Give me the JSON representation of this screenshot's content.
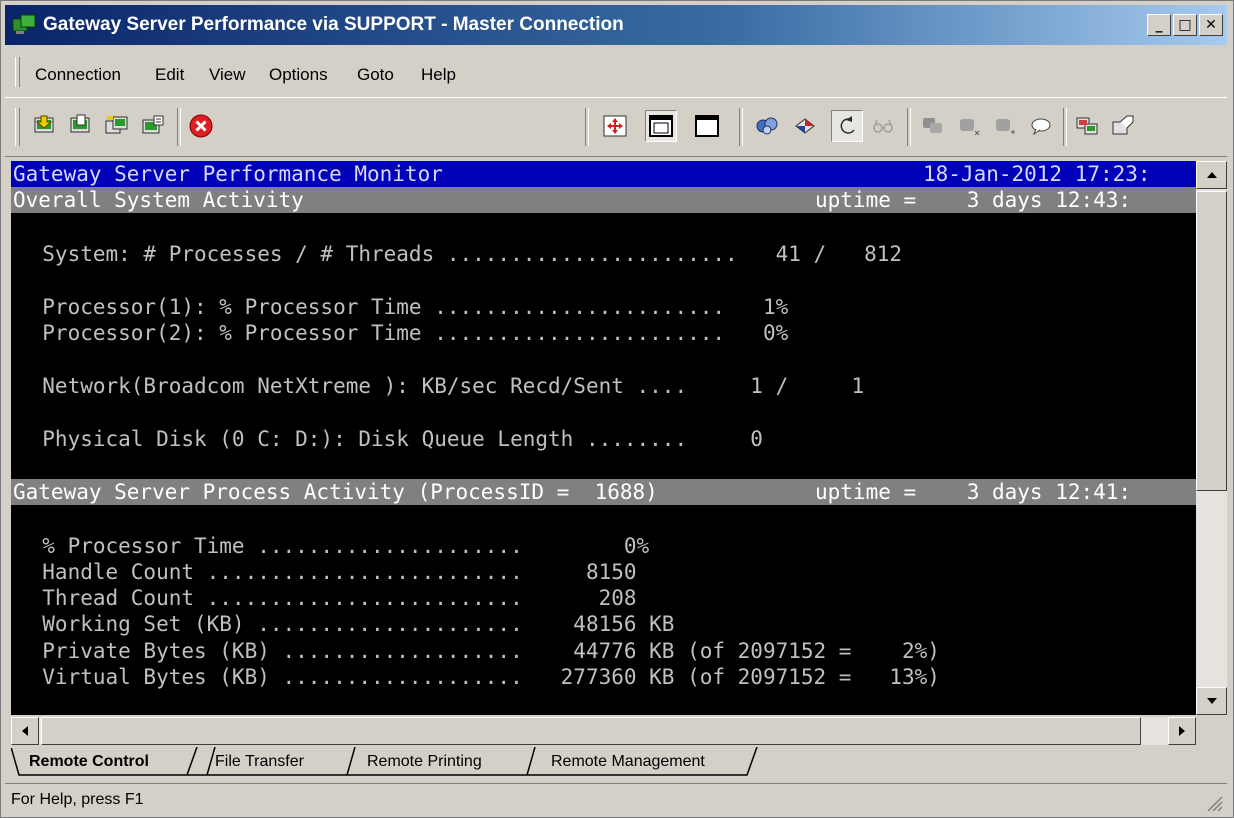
{
  "window": {
    "title": "Gateway Server Performance via SUPPORT - Master Connection",
    "controls": {
      "minimize": "_",
      "maximize": "□",
      "close": "✕"
    }
  },
  "menu": {
    "items": [
      "Connection",
      "Edit",
      "View",
      "Options",
      "Goto",
      "Help"
    ]
  },
  "toolbar": {
    "icons": [
      "connect-icon",
      "disconnect-icon",
      "connect-all-icon",
      "properties-icon",
      "stop-icon",
      "full-screen-icon",
      "window-mode-icon",
      "blank-screen-icon",
      "send-keys-icon",
      "clipboard-icon",
      "undo-icon",
      "view-only-icon",
      "chat-icon",
      "remote-chat-icon",
      "transfer-icon",
      "speech-icon",
      "settings-icon",
      "help-icon"
    ]
  },
  "terminal": {
    "header_title": "Gateway Server Performance Monitor",
    "header_datetime": "18-Jan-2012 17:23:",
    "section1": {
      "title": "Overall System Activity",
      "uptime": "uptime =    3 days 12:43:"
    },
    "section1_lines": [
      "  System: # Processes / # Threads .......................   41 /   812",
      "  Processor(1): % Processor Time .......................   1%",
      "  Processor(2): % Processor Time .......................   0%",
      "  Network(Broadcom NetXtreme ): KB/sec Recd/Sent ....     1 /     1",
      "  Physical Disk (0 C: D:): Disk Queue Length ........     0"
    ],
    "section2": {
      "title": "Gateway Server Process Activity (ProcessID =  1688)",
      "uptime": "uptime =    3 days 12:41:"
    },
    "section2_lines": [
      "  % Processor Time .....................        0%",
      "  Handle Count .........................     8150",
      "  Thread Count .........................      208",
      "  Working Set (KB) .....................    48156 KB",
      "  Private Bytes (KB) ...................    44776 KB (of 2097152 =    2%)",
      "  Virtual Bytes (KB) ...................   277360 KB (of 2097152 =   13%)"
    ]
  },
  "tabs": [
    "Remote Control",
    "File Transfer",
    "Remote Printing",
    "Remote Management"
  ],
  "status": {
    "text": "For Help, press F1"
  }
}
